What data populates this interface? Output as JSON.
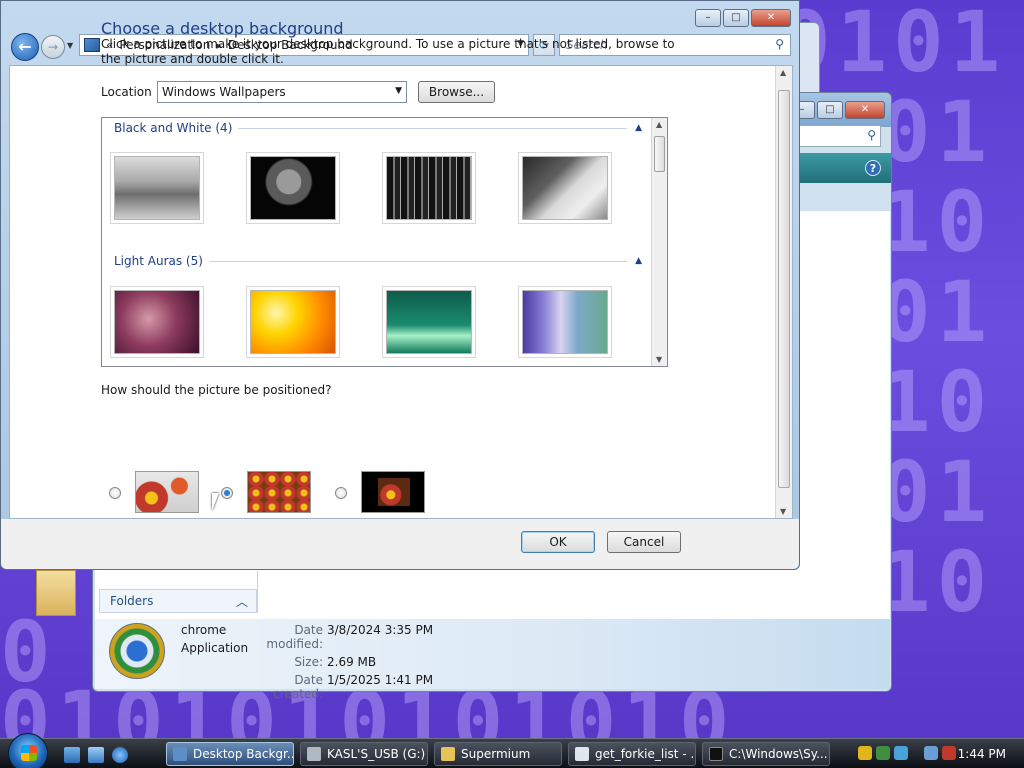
{
  "dialog": {
    "address": {
      "chevrons": "«",
      "crumb1": "Personalization",
      "sep": "▸",
      "crumb2": "Desktop Background"
    },
    "search_placeholder": "Search",
    "heading": "Choose a desktop background",
    "description": "Click a picture to make it your desktop background. To use a picture that's not listed, browse to the picture and double click it.",
    "location_label": "Location",
    "location_value": "Windows Wallpapers",
    "browse_label": "Browse...",
    "groups": [
      {
        "label": "Black and White (4)"
      },
      {
        "label": "Light Auras (5)"
      }
    ],
    "position_question": "How should the picture be positioned?",
    "position_selected": 2,
    "ok_label": "OK",
    "cancel_label": "Cancel"
  },
  "explorer": {
    "folders_label": "Folders",
    "file_name": "chrome",
    "file_type": "Application",
    "date_modified_label": "Date modified:",
    "date_modified": "3/8/2024 3:35 PM",
    "size_label": "Size:",
    "size": "2.69 MB",
    "date_created_label": "Date created:",
    "date_created": "1/5/2025 1:41 PM"
  },
  "taskbar": {
    "tasks": [
      {
        "label": "Desktop Backgr..."
      },
      {
        "label": "KASL'S_USB (G:)"
      },
      {
        "label": "Supermium"
      },
      {
        "label": "get_forkie_list - ..."
      },
      {
        "label": "C:\\Windows\\Sy..."
      }
    ],
    "clock": "1:44 PM"
  },
  "colors": {
    "accent": "#1e3f86",
    "wallpaper": "#6b4ee0"
  }
}
